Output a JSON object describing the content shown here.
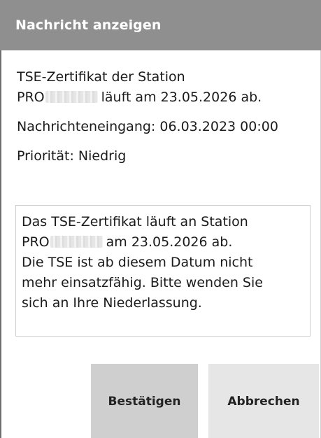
{
  "dialog": {
    "title": "Nachricht anzeigen",
    "summary": {
      "line1": "TSE-Zertifikat der Station",
      "line2_prefix": "PRO",
      "line2_suffix": "läuft am 23.05.2026 ab.",
      "received": "Nachrichteneingang: 06.03.2023 00:00",
      "priority": "Priorität: Niedrig"
    },
    "message": {
      "line1": "Das TSE-Zertifikat läuft an Station",
      "line2_prefix": "PRO",
      "line2_suffix": "am 23.05.2026 ab.",
      "line3": "Die TSE ist ab diesem Datum nicht",
      "line4": "mehr einsatzfähig. Bitte wenden Sie",
      "line5": "sich an Ihre Niederlassung."
    },
    "buttons": {
      "confirm": "Bestätigen",
      "cancel": "Abbrechen"
    }
  },
  "colors": {
    "title_bar": "#8f8f8f",
    "confirm_button": "#cfcfcf",
    "cancel_button": "#e6e6e6"
  }
}
